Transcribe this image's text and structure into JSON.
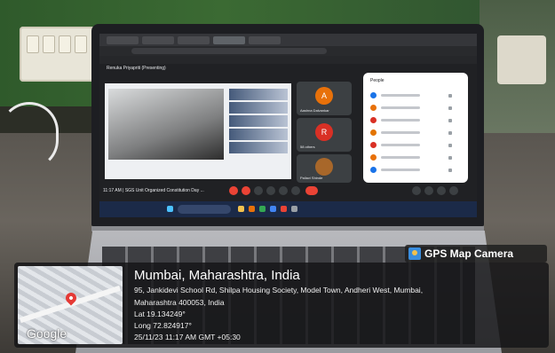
{
  "meet": {
    "presenter_title": "Renuka Priyapriti (Presenting)",
    "tiles": [
      {
        "name": "Aashna Dalvankar",
        "initial": "A",
        "color": "#e8710a"
      },
      {
        "name": "58 others",
        "initial": "R",
        "color": "#d93025"
      },
      {
        "name": "Pallavi Shinde",
        "initial": "",
        "color": "#a8672a"
      }
    ],
    "people_header": "People",
    "people_dots": [
      "#1a73e8",
      "#e8710a",
      "#d93025",
      "#e37400",
      "#d93025",
      "#e8710a",
      "#1a73e8"
    ],
    "meeting_label": "11:17 AM | SGS Unit Organized Constitution Day ..."
  },
  "overlay": {
    "badge_label": "GPS Map Camera",
    "location_title": "Mumbai, Maharashtra, India",
    "address_line1": "95, Jankidevi School Rd, Shilpa Housing Society, Model Town, Andheri West, Mumbai,",
    "address_line2": "Maharashtra 400053, India",
    "latitude": "Lat 19.134249°",
    "longitude": "Long 72.824917°",
    "timestamp": "25/11/23 11:17 AM GMT +05:30",
    "map_brand": "Google"
  },
  "colors": {
    "taskbar": "#1b2a48",
    "end_call": "#ea4335",
    "overlay_bg": "#141416"
  }
}
